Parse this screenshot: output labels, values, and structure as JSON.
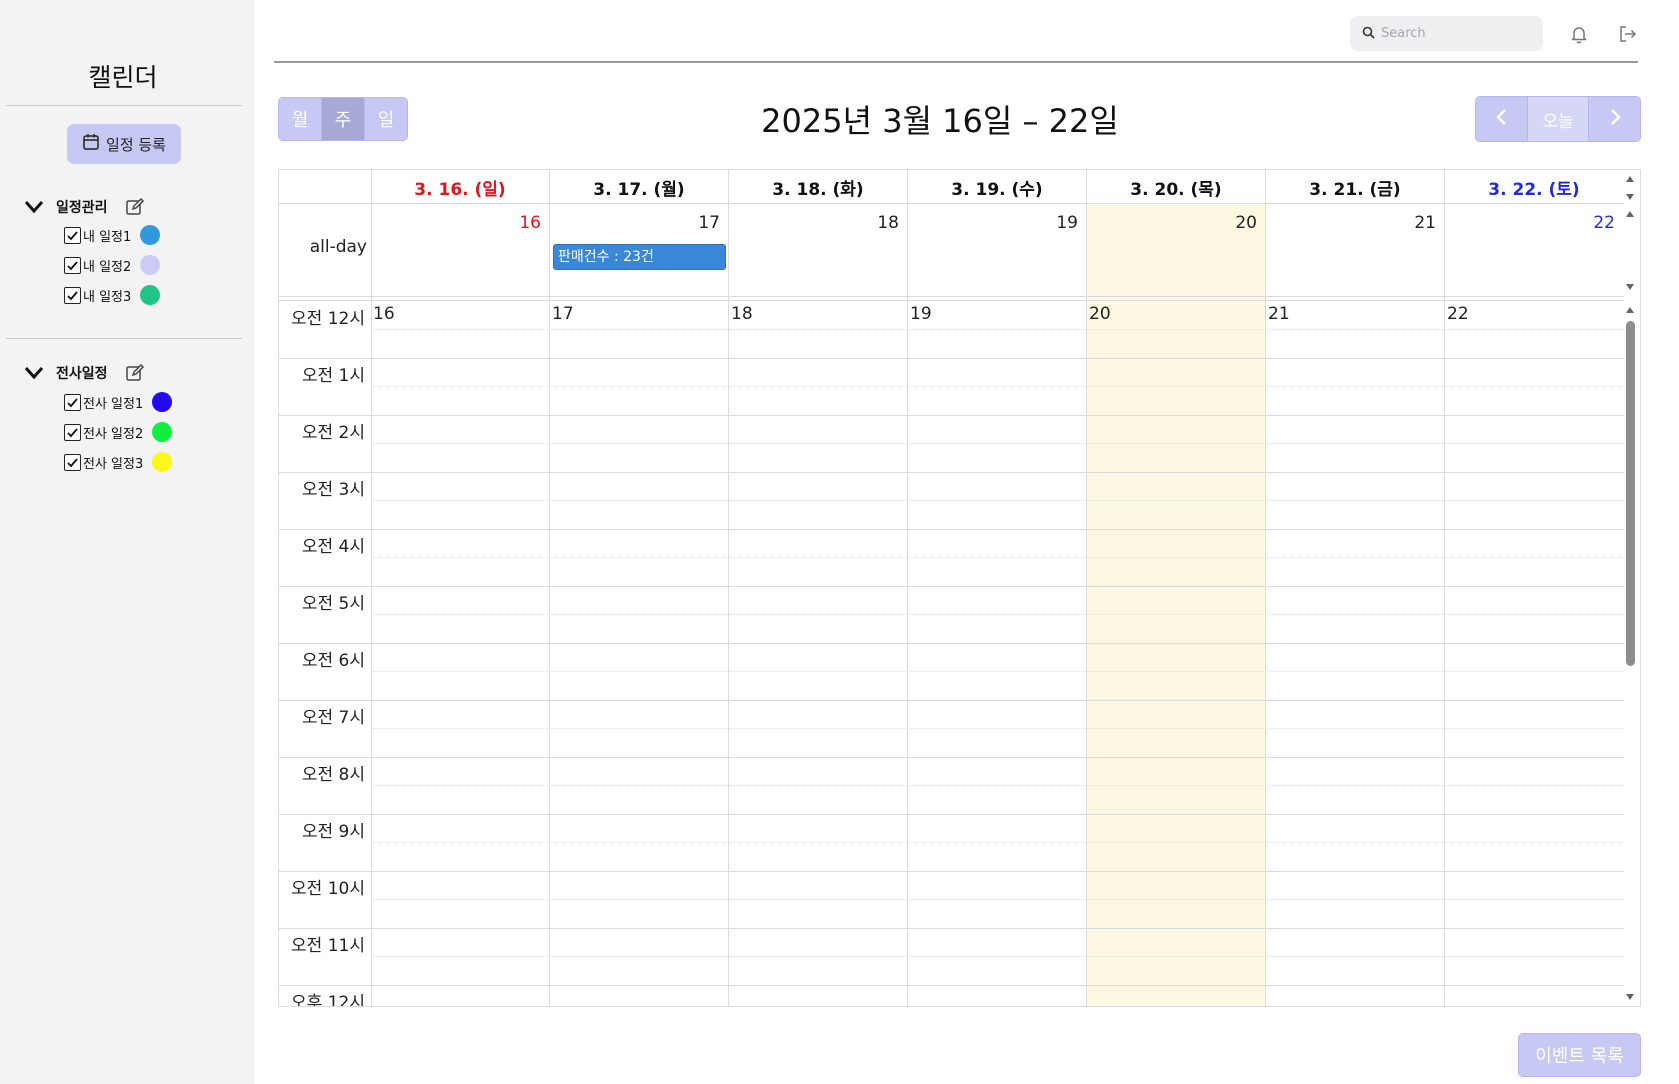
{
  "sidebar": {
    "title": "캘린더",
    "add_button": "일정 등록",
    "groups": [
      {
        "label": "일정관리",
        "items": [
          {
            "label": "내 일정1",
            "color": "#2f99dc"
          },
          {
            "label": "내 일정2",
            "color": "#cbcbf6"
          },
          {
            "label": "내 일정3",
            "color": "#20c489"
          }
        ]
      },
      {
        "label": "전사일정",
        "items": [
          {
            "label": "전사 일정1",
            "color": "#2208ee"
          },
          {
            "label": "전사 일정2",
            "color": "#10ee3e"
          },
          {
            "label": "전사 일정3",
            "color": "#fbf61b"
          }
        ]
      }
    ]
  },
  "topbar": {
    "search_placeholder": "Search",
    "icons": [
      "bell-icon",
      "logout-icon"
    ]
  },
  "toolbar": {
    "views": [
      "월",
      "주",
      "일"
    ],
    "active_view": "주",
    "title": "2025년 3월 16일 – 22일",
    "prev_icon": "chevron-left-icon",
    "today_label": "오늘",
    "next_icon": "chevron-right-icon"
  },
  "calendar": {
    "days": [
      {
        "header": "3. 16. (일)",
        "num": "16",
        "kind": "sun"
      },
      {
        "header": "3. 17. (월)",
        "num": "17",
        "kind": "weekday"
      },
      {
        "header": "3. 18. (화)",
        "num": "18",
        "kind": "weekday"
      },
      {
        "header": "3. 19. (수)",
        "num": "19",
        "kind": "weekday"
      },
      {
        "header": "3. 20. (목)",
        "num": "20",
        "kind": "today"
      },
      {
        "header": "3. 21. (금)",
        "num": "21",
        "kind": "weekday"
      },
      {
        "header": "3. 22. (토)",
        "num": "22",
        "kind": "sat"
      }
    ],
    "allday_label": "all-day",
    "event": {
      "title": "판매건수 : 23건",
      "day": "3. 17. (월)",
      "color": "#3a87d8"
    },
    "time_slots": [
      "오전 12시",
      "오전 1시",
      "오전 2시",
      "오전 3시",
      "오전 4시",
      "오전 5시",
      "오전 6시",
      "오전 7시",
      "오전 8시",
      "오전 9시",
      "오전 10시",
      "오전 11시",
      "오후 12시"
    ],
    "today_highlight": "#fdf8e1"
  },
  "footer": {
    "event_list_button": "이벤트 목록"
  },
  "colors": {
    "accent": "#c8c8f5",
    "accent_active": "#a8a8d6",
    "sunday": "#e3141a",
    "saturday": "#1f2cd6"
  }
}
